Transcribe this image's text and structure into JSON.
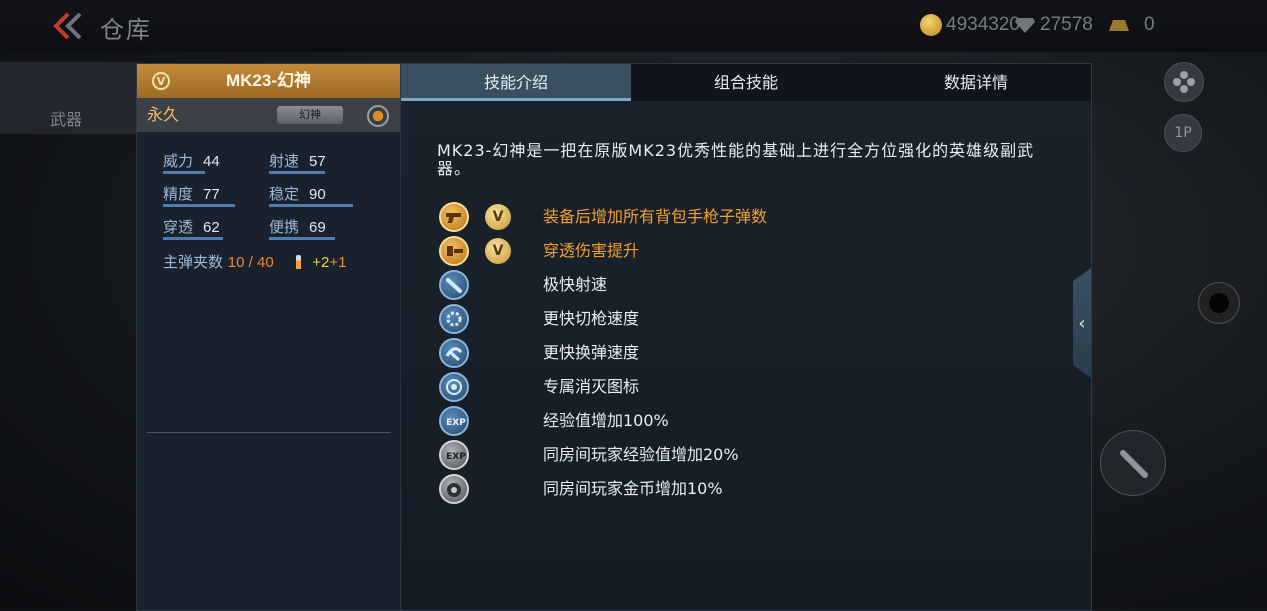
{
  "topbar": {
    "title": "仓库",
    "coins": "4934320",
    "diamonds": "27578",
    "gold": "0"
  },
  "sidebar": {
    "weapon_label": "武器"
  },
  "right_controls": {
    "badge": "1P"
  },
  "weapon": {
    "name": "MK23-幻神",
    "badge": "V",
    "duration": "永久",
    "skin_tag": "幻神",
    "stats": [
      {
        "label": "威力",
        "value": "44"
      },
      {
        "label": "射速",
        "value": "57"
      },
      {
        "label": "精度",
        "value": "77"
      },
      {
        "label": "稳定",
        "value": "90"
      },
      {
        "label": "穿透",
        "value": "62"
      },
      {
        "label": "便携",
        "value": "69"
      }
    ],
    "ammo_label": "主弹夹数",
    "ammo_value": "10 / 40",
    "ammo_bonus1": "+2",
    "ammo_bonus2": "+1"
  },
  "tabs": [
    {
      "label": "技能介绍",
      "active": true
    },
    {
      "label": "组合技能",
      "active": false
    },
    {
      "label": "数据详情",
      "active": false
    }
  ],
  "description": "MK23-幻神是一把在原版MK23优秀性能的基础上进行全方位强化的英雄级副武器。",
  "skills": [
    {
      "icon": "pistol-icon",
      "hero": true,
      "text": "装备后增加所有背包手枪子弹数",
      "color": "orange"
    },
    {
      "icon": "penetration-icon",
      "hero": true,
      "text": "穿透伤害提升",
      "color": "orange"
    },
    {
      "icon": "fire-rate-icon",
      "hero": false,
      "text": "极快射速",
      "color": "white"
    },
    {
      "icon": "switch-weapon-icon",
      "hero": false,
      "text": "更快切枪速度",
      "color": "white"
    },
    {
      "icon": "reload-icon",
      "hero": false,
      "text": "更快换弹速度",
      "color": "white"
    },
    {
      "icon": "kill-icon",
      "hero": false,
      "text": "专属消灭图标",
      "color": "white"
    },
    {
      "icon": "exp-icon",
      "hero": false,
      "text": "经验值增加100%",
      "color": "white",
      "glyph": "EXP"
    },
    {
      "icon": "room-exp-icon",
      "hero": false,
      "text": "同房间玩家经验值增加20%",
      "color": "white",
      "glyph": "EXP"
    },
    {
      "icon": "room-coin-icon",
      "hero": false,
      "text": "同房间玩家金币增加10%",
      "color": "white"
    }
  ],
  "colors": {
    "accent_orange": "#f0a030",
    "tab_active": "#3a5060",
    "header_gold": "#c48b3a",
    "stat_bar": "#4f7db0"
  }
}
